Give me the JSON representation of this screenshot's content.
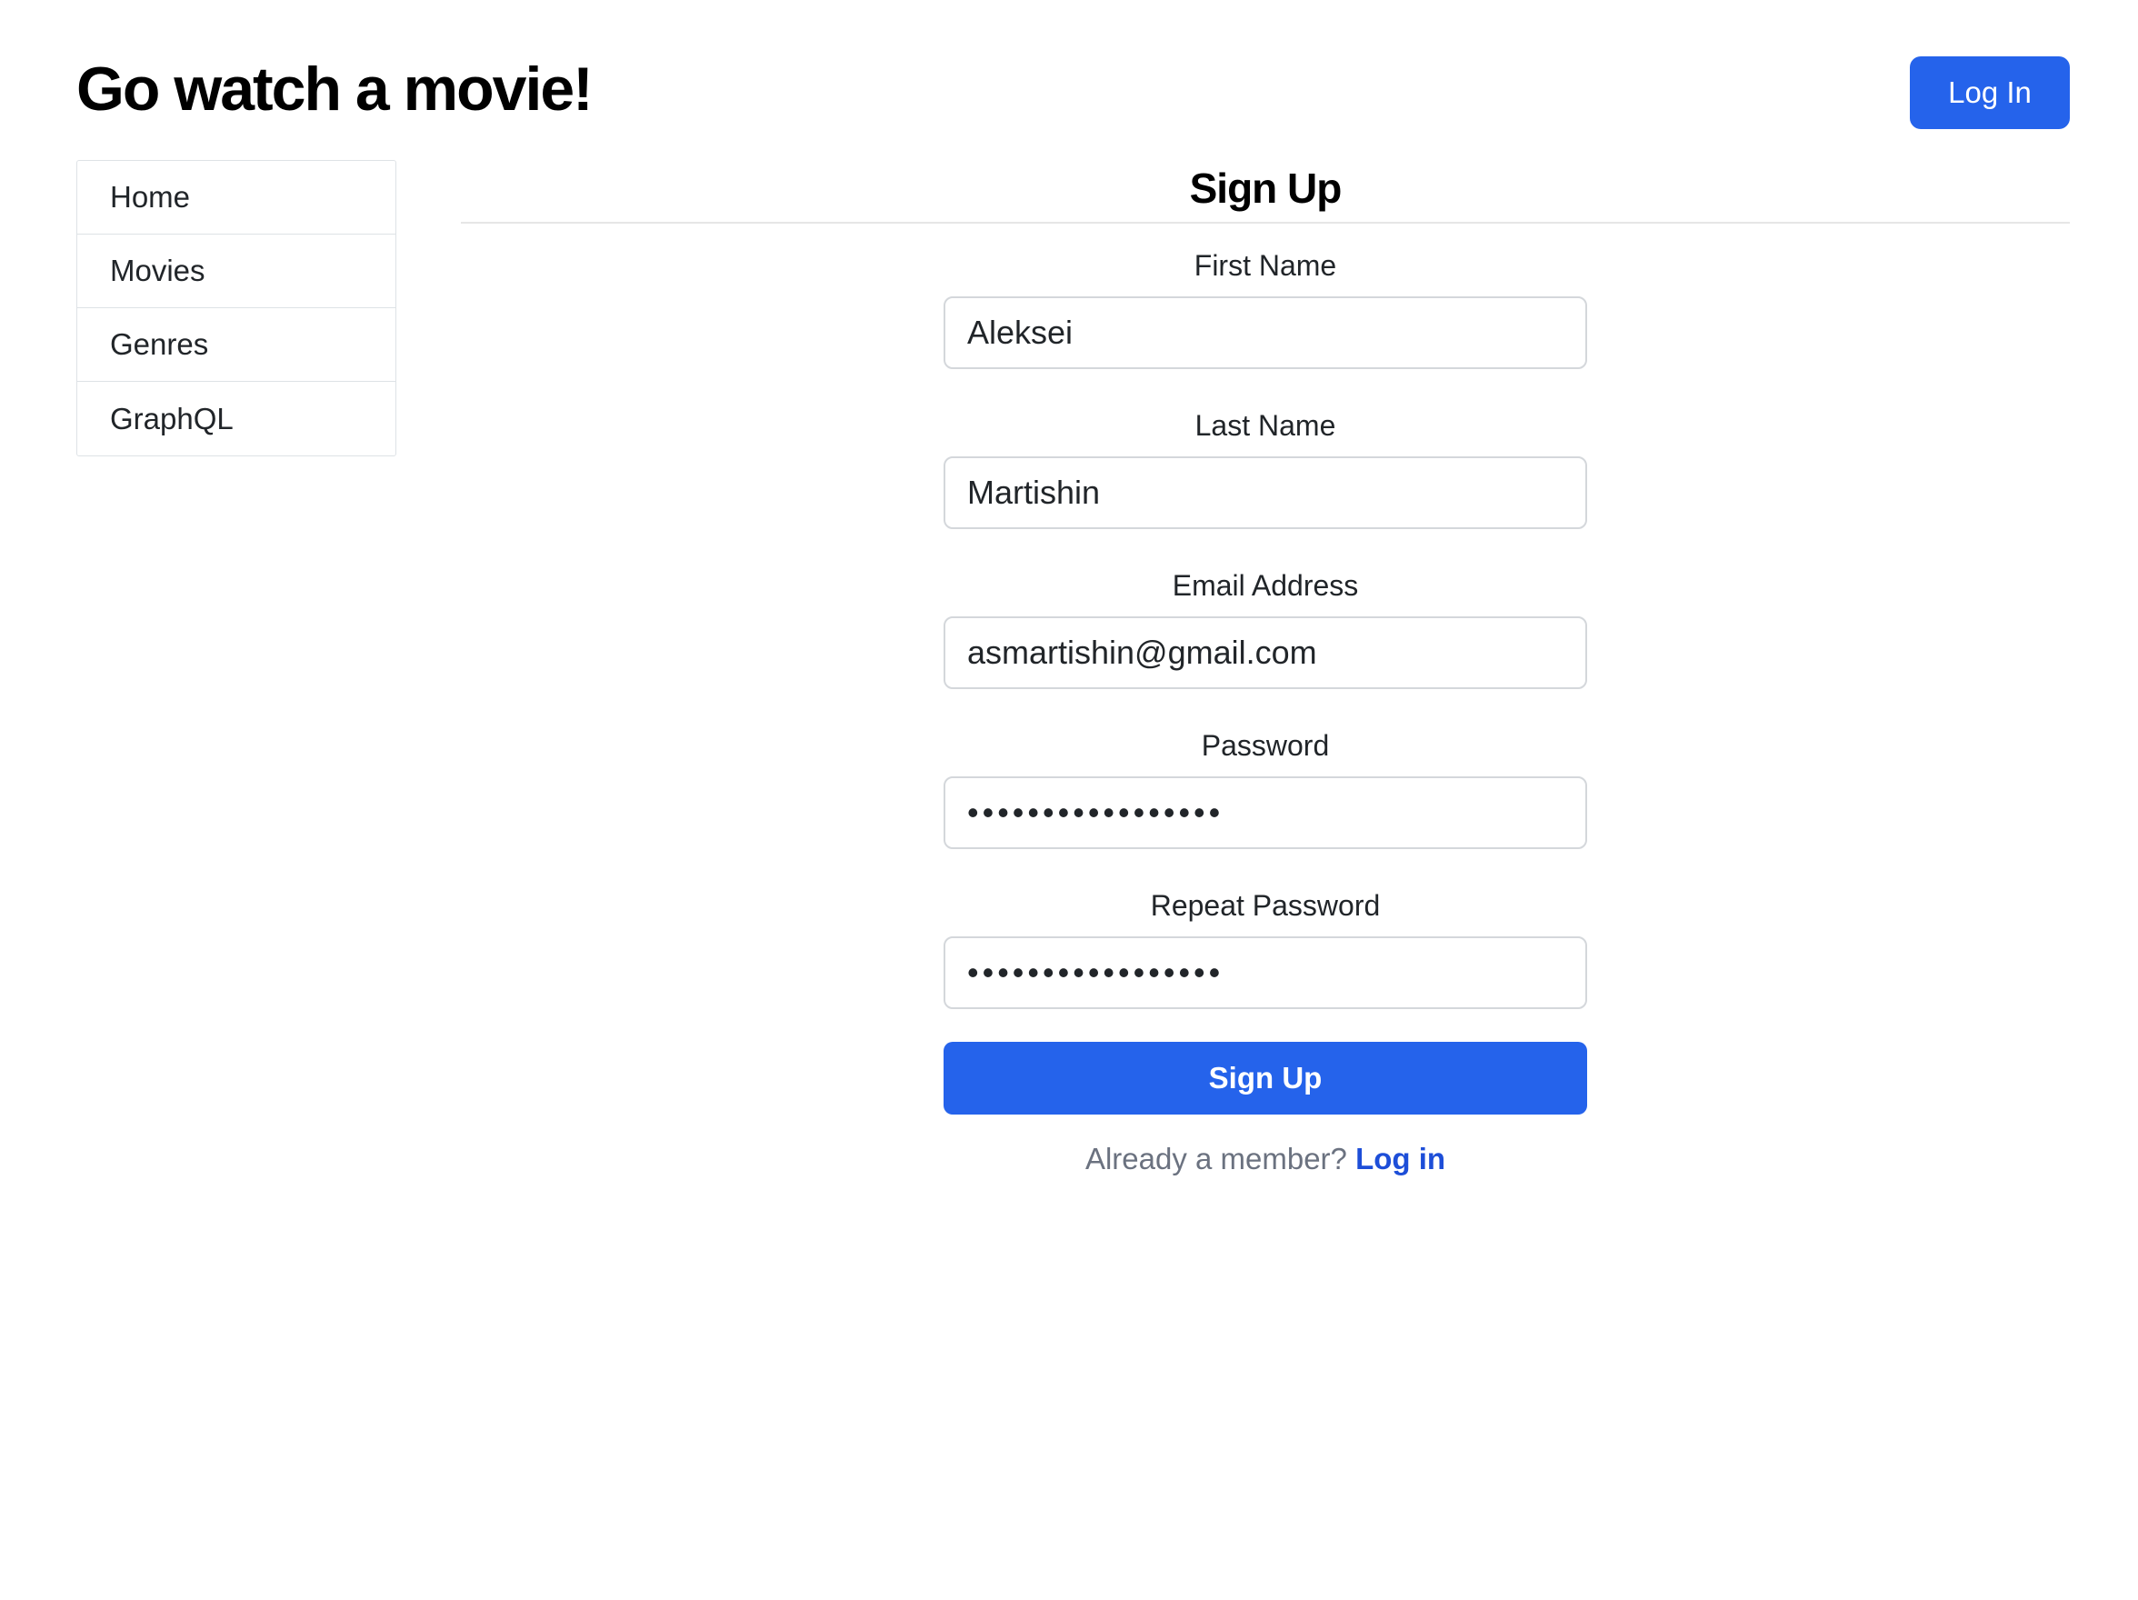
{
  "header": {
    "title": "Go watch a movie!",
    "login_label": "Log In"
  },
  "sidebar": {
    "items": [
      {
        "label": "Home"
      },
      {
        "label": "Movies"
      },
      {
        "label": "Genres"
      },
      {
        "label": "GraphQL"
      }
    ]
  },
  "main": {
    "title": "Sign Up",
    "form": {
      "first_name": {
        "label": "First Name",
        "value": "Aleksei"
      },
      "last_name": {
        "label": "Last Name",
        "value": "Martishin"
      },
      "email": {
        "label": "Email Address",
        "value": "asmartishin@gmail.com"
      },
      "password": {
        "label": "Password",
        "value": "•••••••••••••••••"
      },
      "repeat_password": {
        "label": "Repeat Password",
        "value": "•••••••••••••••••"
      },
      "submit_label": "Sign Up"
    },
    "footer": {
      "prompt": "Already a member?",
      "link_label": "Log in"
    }
  },
  "colors": {
    "primary": "#2563eb",
    "link": "#1d4ed8",
    "muted_text": "#6b7280",
    "border": "#dee2e6"
  }
}
